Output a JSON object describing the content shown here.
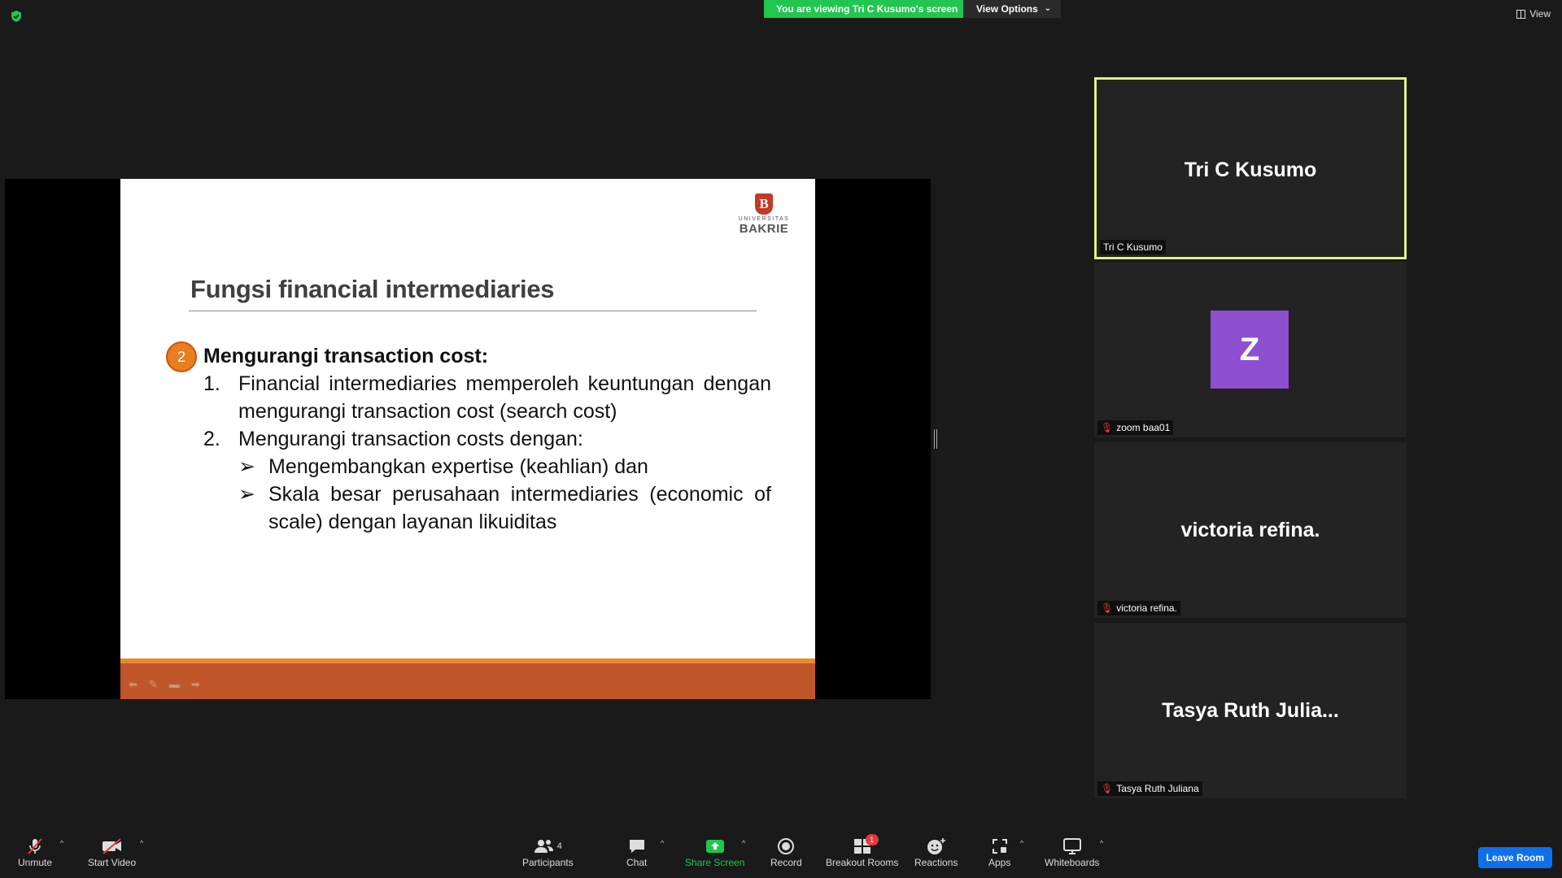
{
  "banner": {
    "viewing_text": "You are viewing Tri C Kusumo's screen",
    "view_options_label": "View Options"
  },
  "top_right": {
    "view_label": "View"
  },
  "slide": {
    "logo_small": "UNIVERSITAS",
    "logo_big": "BAKRIE",
    "logo_crest": "B",
    "title": "Fungsi financial intermediaries",
    "number": "2",
    "heading": "Mengurangi transaction cost:",
    "items": [
      {
        "n": "1.",
        "text": "Financial intermediaries memperoleh keuntungan dengan mengurangi transaction cost (search cost)"
      },
      {
        "n": "2.",
        "text": "Mengurangi transaction costs dengan:"
      }
    ],
    "subitems": [
      "Mengembangkan expertise (keahlian) dan",
      "Skala besar perusahaan intermediaries (economic of scale) dengan layanan likuiditas"
    ]
  },
  "participants": [
    {
      "display": "Tri C Kusumo",
      "label": "Tri C Kusumo"
    },
    {
      "avatar": "Z",
      "label": "zoom baa01"
    },
    {
      "display": "victoria refina.",
      "label": "victoria refina."
    },
    {
      "display": "Tasya Ruth Julia...",
      "label": "Tasya Ruth Juliana"
    }
  ],
  "toolbar": {
    "unmute": "Unmute",
    "start_video": "Start Video",
    "participants": "Participants",
    "participants_count": "4",
    "chat": "Chat",
    "share_screen": "Share Screen",
    "record": "Record",
    "breakout_rooms": "Breakout Rooms",
    "breakout_badge": "1",
    "reactions": "Reactions",
    "apps": "Apps",
    "whiteboards": "Whiteboards",
    "leave_room": "Leave Room"
  }
}
